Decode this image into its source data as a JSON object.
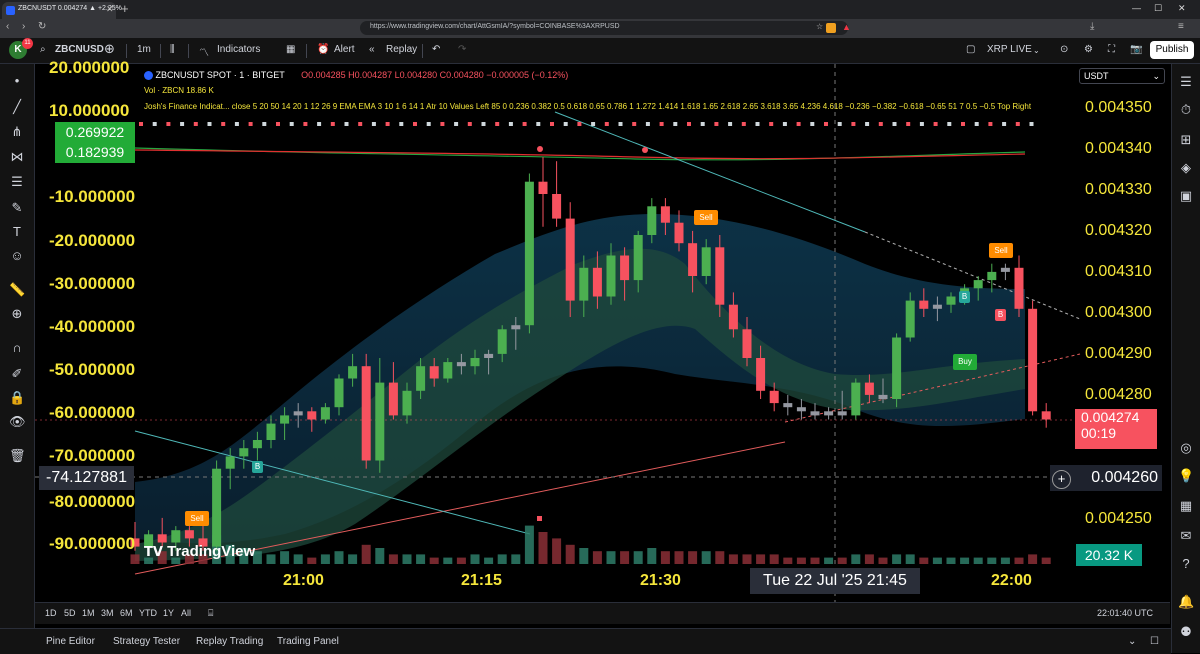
{
  "browser": {
    "tab_title": "ZBCNUSDT 0.004274 ▲ +2.25%",
    "url": "https://www.tradingview.com/chart/AttGsmIA/?symbol=COINBASE%3AXRPUSD"
  },
  "toolbar": {
    "avatar_letter": "K",
    "avatar_badge": "11",
    "symbol": "ZBCNUSD",
    "interval": "1m",
    "indicators": "Indicators",
    "alert": "Alert",
    "replay": "Replay",
    "layout_name": "XRP LIVE",
    "publish": "Publish"
  },
  "legend": {
    "symbol_line": "ZBCNUSDT SPOT · 1 · BITGET",
    "ohlc": "O0.004285 H0.004287 L0.004280 C0.004280 −0.000005 (−0.12%)",
    "volume": "Vol · ZBCN  18.86 K",
    "indicator": "Josh's Finance Indicat... close 5 20 50 14 20 1 12 26 9 EMA EMA 3 10 1 6 14 1 Atr 10 Values Left 85 0 0.236 0.382 0.5 0.618 0.65 0.786 1 1.272 1.414 1.618 1.65 2.618 2.65 3.618 3.65 4.236 4.618 −0.236 −0.382 −0.618 −0.65 51 7 0.5 −0.5 Top Right"
  },
  "left_axis": {
    "labels": [
      "20.000000",
      "10.000000",
      "-10.000000",
      "-20.000000",
      "-30.000000",
      "-40.000000",
      "-50.000000",
      "-60.000000",
      "-70.000000",
      "-80.000000",
      "-90.000000"
    ],
    "green_values": [
      "0.269922",
      "0.182939"
    ],
    "crosshair_value": "-74.127881"
  },
  "right_axis": {
    "currency": "USDT",
    "labels": [
      "0.004350",
      "0.004340",
      "0.004330",
      "0.004320",
      "0.004310",
      "0.004300",
      "0.004290",
      "0.004280",
      "0.004250"
    ],
    "current_price": "0.004274",
    "countdown": "00:19",
    "crosshair_price": "0.004260",
    "volume_label": "20.32 K"
  },
  "time_axis": {
    "labels": [
      "21:00",
      "21:15",
      "21:30",
      "22:00"
    ],
    "crosshair_date": "Tue 22 Jul '25   21:45"
  },
  "signals": {
    "sell": "Sell",
    "buy": "Buy",
    "b": "B"
  },
  "watermark": "TradingView",
  "range_bar": {
    "ranges": [
      "1D",
      "5D",
      "1M",
      "3M",
      "6M",
      "YTD",
      "1Y",
      "All"
    ],
    "clock": "22:01:40 UTC"
  },
  "bottom_panel": {
    "tabs": [
      "Pine Editor",
      "Strategy Tester",
      "Replay Trading",
      "Trading Panel"
    ]
  },
  "colors": {
    "up": "#4caf50",
    "down": "#f7525f",
    "doji": "#9598a1",
    "axis_text": "#f5e63b",
    "accent_green": "#22ab37"
  },
  "chart_data": {
    "type": "candlestick",
    "symbol": "ZBCNUSDT",
    "exchange": "BITGET",
    "interval": "1m",
    "price_axis": [
      0.00425,
      0.00435
    ],
    "current_price": 0.004274,
    "candles": [
      {
        "o": 0.004246,
        "h": 0.00425,
        "l": 0.004243,
        "c": 0.004244
      },
      {
        "o": 0.004244,
        "h": 0.004248,
        "l": 0.004243,
        "c": 0.004247
      },
      {
        "o": 0.004247,
        "h": 0.004251,
        "l": 0.004244,
        "c": 0.004245
      },
      {
        "o": 0.004245,
        "h": 0.004249,
        "l": 0.004243,
        "c": 0.004248
      },
      {
        "o": 0.004248,
        "h": 0.00425,
        "l": 0.004244,
        "c": 0.004246
      },
      {
        "o": 0.004246,
        "h": 0.004252,
        "l": 0.004243,
        "c": 0.004244
      },
      {
        "o": 0.004244,
        "h": 0.004265,
        "l": 0.004243,
        "c": 0.004263
      },
      {
        "o": 0.004263,
        "h": 0.004268,
        "l": 0.004258,
        "c": 0.004266
      },
      {
        "o": 0.004266,
        "h": 0.00427,
        "l": 0.004263,
        "c": 0.004268
      },
      {
        "o": 0.004268,
        "h": 0.004272,
        "l": 0.004265,
        "c": 0.00427
      },
      {
        "o": 0.00427,
        "h": 0.004276,
        "l": 0.004268,
        "c": 0.004274
      },
      {
        "o": 0.004274,
        "h": 0.004278,
        "l": 0.00427,
        "c": 0.004276
      },
      {
        "o": 0.004276,
        "h": 0.004279,
        "l": 0.004273,
        "c": 0.004277
      },
      {
        "o": 0.004277,
        "h": 0.004278,
        "l": 0.004272,
        "c": 0.004275
      },
      {
        "o": 0.004275,
        "h": 0.004279,
        "l": 0.004274,
        "c": 0.004278
      },
      {
        "o": 0.004278,
        "h": 0.004286,
        "l": 0.004276,
        "c": 0.004285
      },
      {
        "o": 0.004285,
        "h": 0.004291,
        "l": 0.004283,
        "c": 0.004288
      },
      {
        "o": 0.004288,
        "h": 0.004291,
        "l": 0.004263,
        "c": 0.004265
      },
      {
        "o": 0.004265,
        "h": 0.00429,
        "l": 0.004262,
        "c": 0.004284
      },
      {
        "o": 0.004284,
        "h": 0.004289,
        "l": 0.004275,
        "c": 0.004276
      },
      {
        "o": 0.004276,
        "h": 0.004284,
        "l": 0.004274,
        "c": 0.004282
      },
      {
        "o": 0.004282,
        "h": 0.00429,
        "l": 0.00428,
        "c": 0.004288
      },
      {
        "o": 0.004288,
        "h": 0.00429,
        "l": 0.004283,
        "c": 0.004285
      },
      {
        "o": 0.004285,
        "h": 0.00429,
        "l": 0.004284,
        "c": 0.004289
      },
      {
        "o": 0.004289,
        "h": 0.004291,
        "l": 0.004286,
        "c": 0.004288
      },
      {
        "o": 0.004288,
        "h": 0.004292,
        "l": 0.004286,
        "c": 0.00429
      },
      {
        "o": 0.00429,
        "h": 0.004292,
        "l": 0.004286,
        "c": 0.004291
      },
      {
        "o": 0.004291,
        "h": 0.004298,
        "l": 0.004289,
        "c": 0.004297
      },
      {
        "o": 0.004297,
        "h": 0.0043,
        "l": 0.004292,
        "c": 0.004298
      },
      {
        "o": 0.004298,
        "h": 0.004335,
        "l": 0.004296,
        "c": 0.004333
      },
      {
        "o": 0.004333,
        "h": 0.004339,
        "l": 0.004322,
        "c": 0.00433
      },
      {
        "o": 0.00433,
        "h": 0.004338,
        "l": 0.004322,
        "c": 0.004324
      },
      {
        "o": 0.004324,
        "h": 0.004328,
        "l": 0.0043,
        "c": 0.004304
      },
      {
        "o": 0.004304,
        "h": 0.004315,
        "l": 0.0043,
        "c": 0.004312
      },
      {
        "o": 0.004312,
        "h": 0.004316,
        "l": 0.004302,
        "c": 0.004305
      },
      {
        "o": 0.004305,
        "h": 0.004318,
        "l": 0.004303,
        "c": 0.004315
      },
      {
        "o": 0.004315,
        "h": 0.004317,
        "l": 0.004304,
        "c": 0.004309
      },
      {
        "o": 0.004309,
        "h": 0.004321,
        "l": 0.004306,
        "c": 0.00432
      },
      {
        "o": 0.00432,
        "h": 0.004329,
        "l": 0.004318,
        "c": 0.004327
      },
      {
        "o": 0.004327,
        "h": 0.004329,
        "l": 0.00432,
        "c": 0.004323
      },
      {
        "o": 0.004323,
        "h": 0.004326,
        "l": 0.004316,
        "c": 0.004318
      },
      {
        "o": 0.004318,
        "h": 0.004321,
        "l": 0.004306,
        "c": 0.00431
      },
      {
        "o": 0.00431,
        "h": 0.004319,
        "l": 0.004308,
        "c": 0.004317
      },
      {
        "o": 0.004317,
        "h": 0.00432,
        "l": 0.0043,
        "c": 0.004303
      },
      {
        "o": 0.004303,
        "h": 0.004306,
        "l": 0.004295,
        "c": 0.004297
      },
      {
        "o": 0.004297,
        "h": 0.0043,
        "l": 0.004288,
        "c": 0.00429
      },
      {
        "o": 0.00429,
        "h": 0.004293,
        "l": 0.00428,
        "c": 0.004282
      },
      {
        "o": 0.004282,
        "h": 0.004284,
        "l": 0.004277,
        "c": 0.004279
      },
      {
        "o": 0.004279,
        "h": 0.004281,
        "l": 0.004276,
        "c": 0.004278
      },
      {
        "o": 0.004278,
        "h": 0.00428,
        "l": 0.004275,
        "c": 0.004277
      },
      {
        "o": 0.004277,
        "h": 0.004279,
        "l": 0.004275,
        "c": 0.004276
      },
      {
        "o": 0.004276,
        "h": 0.004278,
        "l": 0.004275,
        "c": 0.004277
      },
      {
        "o": 0.004277,
        "h": 0.004282,
        "l": 0.004275,
        "c": 0.004276
      },
      {
        "o": 0.004276,
        "h": 0.004285,
        "l": 0.004275,
        "c": 0.004284
      },
      {
        "o": 0.004284,
        "h": 0.004286,
        "l": 0.004279,
        "c": 0.004281
      },
      {
        "o": 0.004281,
        "h": 0.004285,
        "l": 0.004279,
        "c": 0.00428
      },
      {
        "o": 0.00428,
        "h": 0.004296,
        "l": 0.004278,
        "c": 0.004295
      },
      {
        "o": 0.004295,
        "h": 0.004306,
        "l": 0.004294,
        "c": 0.004304
      },
      {
        "o": 0.004304,
        "h": 0.004307,
        "l": 0.0043,
        "c": 0.004302
      },
      {
        "o": 0.004302,
        "h": 0.004305,
        "l": 0.004299,
        "c": 0.004303
      },
      {
        "o": 0.004303,
        "h": 0.004306,
        "l": 0.004301,
        "c": 0.004305
      },
      {
        "o": 0.004305,
        "h": 0.004308,
        "l": 0.004303,
        "c": 0.004307
      },
      {
        "o": 0.004307,
        "h": 0.00431,
        "l": 0.004304,
        "c": 0.004309
      },
      {
        "o": 0.004309,
        "h": 0.004313,
        "l": 0.004306,
        "c": 0.004311
      },
      {
        "o": 0.004311,
        "h": 0.004313,
        "l": 0.004309,
        "c": 0.004312
      },
      {
        "o": 0.004312,
        "h": 0.004315,
        "l": 0.0043,
        "c": 0.004302
      },
      {
        "o": 0.004302,
        "h": 0.004304,
        "l": 0.004276,
        "c": 0.004277
      },
      {
        "o": 0.004277,
        "h": 0.004279,
        "l": 0.004273,
        "c": 0.004275
      }
    ],
    "volume": [
      3,
      2,
      4,
      2,
      3,
      3,
      9,
      6,
      5,
      4,
      3,
      4,
      3,
      2,
      3,
      4,
      3,
      6,
      5,
      3,
      3,
      3,
      2,
      2,
      2,
      3,
      2,
      3,
      3,
      12,
      10,
      8,
      6,
      5,
      4,
      4,
      4,
      4,
      5,
      4,
      4,
      4,
      4,
      4,
      3,
      3,
      3,
      3,
      2,
      2,
      2,
      2,
      2,
      3,
      3,
      2,
      3,
      3,
      2,
      2,
      2,
      2,
      2,
      2,
      2,
      2,
      3,
      2
    ],
    "volume_max": 30
  }
}
